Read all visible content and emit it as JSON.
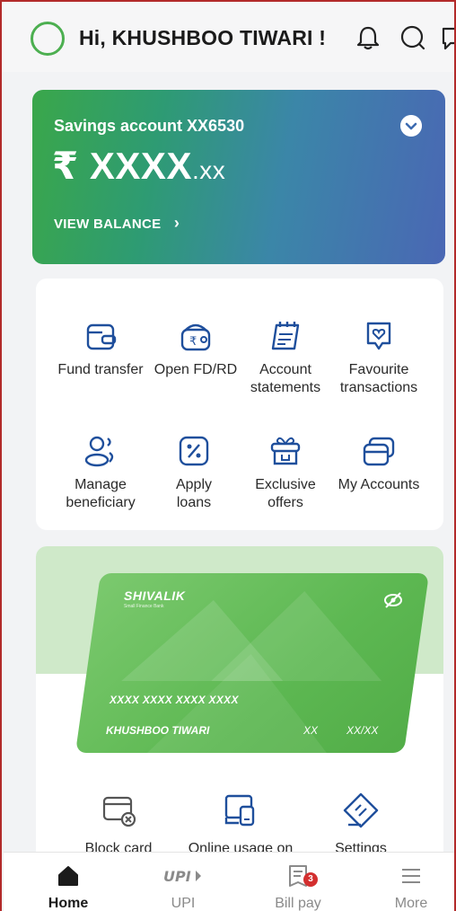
{
  "header": {
    "greeting": "Hi, KHUSHBOO TIWARI !",
    "icons": [
      "bell-icon",
      "search-icon",
      "chat-icon"
    ]
  },
  "account": {
    "title": "Savings account XX6530",
    "currency": "₹",
    "amount_main": "XXXX",
    "amount_decimal": ".xx",
    "view_balance": "VIEW BALANCE",
    "view_balance_arrow": "›"
  },
  "quick_actions": [
    {
      "label_1": "Fund transfer",
      "label_2": "",
      "icon": "wallet-icon"
    },
    {
      "label_1": "Open FD/RD",
      "label_2": "",
      "icon": "rupee-wallet-icon"
    },
    {
      "label_1": "Account",
      "label_2": "statements",
      "icon": "statement-icon"
    },
    {
      "label_1": "Favourite",
      "label_2": "transactions",
      "icon": "heart-tag-icon"
    },
    {
      "label_1": "Manage",
      "label_2": "beneficiary",
      "icon": "users-icon"
    },
    {
      "label_1": "Apply",
      "label_2": "loans",
      "icon": "percent-icon"
    },
    {
      "label_1": "Exclusive",
      "label_2": "offers",
      "icon": "gift-icon"
    },
    {
      "label_1": "My Accounts",
      "label_2": "",
      "icon": "cards-icon"
    }
  ],
  "card": {
    "brand": "SHIVALIK",
    "brand_sub": "Small Finance Bank",
    "number": "XXXX XXXX XXXX XXXX",
    "holder": "KHUSHBOO TIWARI",
    "cvv": "XX",
    "expiry": "XX/XX"
  },
  "card_actions": [
    {
      "label": "Block card",
      "icon": "block-card-icon"
    },
    {
      "label": "Online usage on",
      "icon": "online-usage-icon"
    },
    {
      "label": "Settings",
      "icon": "settings-card-icon"
    }
  ],
  "bottom_nav": [
    {
      "label": "Home",
      "icon": "home-icon",
      "active": true
    },
    {
      "label": "UPI",
      "icon": "upi-logo-icon",
      "active": false
    },
    {
      "label": "Bill pay",
      "icon": "bill-icon",
      "active": false,
      "badge": "3"
    },
    {
      "label": "More",
      "icon": "menu-icon",
      "active": false
    }
  ],
  "colors": {
    "accent_green": "#4caf50",
    "card_green": "#5db852",
    "badge_red": "#d32f2f",
    "icon_blue": "#1f4f9c"
  }
}
